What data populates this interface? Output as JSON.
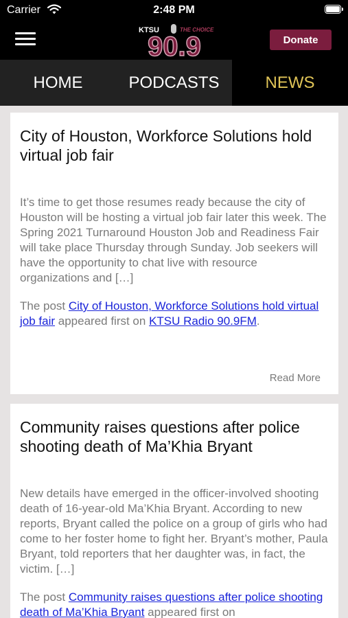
{
  "status_bar": {
    "carrier": "Carrier",
    "time": "2:48 PM"
  },
  "header": {
    "logo": {
      "top_left": "KTSU",
      "top_right": "THE CHOICE",
      "main": "90.9"
    },
    "donate_label": "Donate"
  },
  "tabs": [
    {
      "label": "HOME",
      "active": false
    },
    {
      "label": "PODCASTS",
      "active": false
    },
    {
      "label": "NEWS",
      "active": true
    }
  ],
  "colors": {
    "accent": "#7b1d3e",
    "active_tab": "#e0c457",
    "link": "#1a24d9"
  },
  "posts": [
    {
      "title": "City of Houston, Workforce Solutions hold virtual job fair",
      "excerpt": "It’s time to get those resumes ready because the city of Houston will be hosting a virtual job fair later this week. The Spring 2021 Turnaround Houston Job and Readiness Fair will take place Thursday through Sunday. Job seekers will have the opportunity to chat live with resource organizations and […]",
      "footer_prefix": "The post ",
      "link_text": "City of Houston, Workforce Solutions hold virtual job fair",
      "footer_middle": " appeared first on ",
      "source_link": "KTSU Radio 90.9FM",
      "footer_suffix": ".",
      "read_more": "Read More"
    },
    {
      "title": "Community raises questions after police shooting death of Ma’Khia Bryant",
      "excerpt": "New details have emerged in the officer-involved shooting death of 16-year-old Ma’Khia Bryant. According to new reports, Bryant called the police on a group of girls who had come to her foster home to fight her. Bryant’s mother, Paula Bryant, told reporters that her daughter was, in fact, the victim. […]",
      "footer_prefix": "The post ",
      "link_text": "Community raises questions after police shooting death of Ma’Khia Bryant",
      "footer_middle": " appeared first on"
    }
  ]
}
